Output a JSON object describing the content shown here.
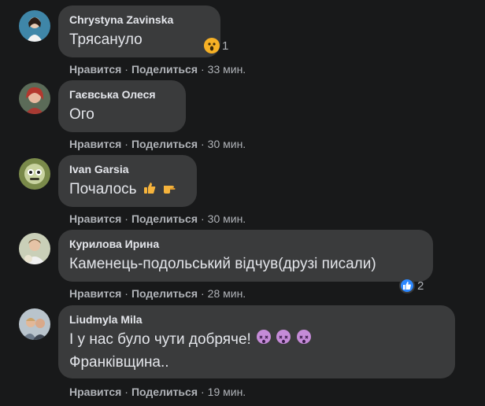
{
  "comments": [
    {
      "author": "Chrystyna Zavinska",
      "lines": [
        "Трясануло"
      ],
      "reaction_icon": "wow-emoji-icon",
      "reaction_count": "1",
      "actions": {
        "like": "Нравится",
        "share": "Поделиться",
        "time": "33 мин."
      }
    },
    {
      "author": "Гаєвська Олеся",
      "lines": [
        "Ого"
      ],
      "actions": {
        "like": "Нравится",
        "share": "Поделиться",
        "time": "30 мин."
      }
    },
    {
      "author": "Ivan Garsia",
      "lines": [
        "Почалось"
      ],
      "emojis": [
        "thumbs-up-emoji-icon",
        "pointing-hand-emoji-icon"
      ],
      "actions": {
        "like": "Нравится",
        "share": "Поделиться",
        "time": "30 мин."
      }
    },
    {
      "author": "Курилова Ирина",
      "lines": [
        "Каменець-подольський відчув(друзі писали)"
      ],
      "reaction_icon": "like-icon",
      "reaction_count": "2",
      "actions": {
        "like": "Нравится",
        "share": "Поделиться",
        "time": "28 мин."
      }
    },
    {
      "author": "Liudmyla Mila",
      "lines": [
        "І у нас було чути добряче!",
        "Франківщина.."
      ],
      "emojis": [
        "dizzy-face-emoji-icon",
        "dizzy-face-emoji-icon",
        "dizzy-face-emoji-icon"
      ],
      "actions": {
        "like": "Нравится",
        "share": "Поделиться",
        "time": "19 мин."
      }
    }
  ],
  "colors": {
    "background": "#18191a",
    "bubble": "#3a3b3c",
    "text": "#e4e6eb",
    "secondary_text": "#b0b3b8",
    "like_blue": "#2d88ff"
  }
}
